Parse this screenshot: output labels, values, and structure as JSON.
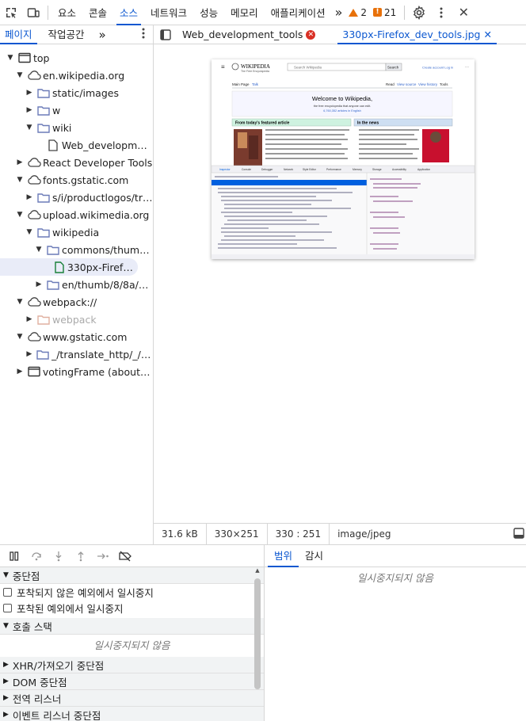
{
  "toolbar": {
    "tabs": [
      "요소",
      "콘솔",
      "소스",
      "네트워크",
      "성능",
      "메모리",
      "애플리케이션"
    ],
    "active_tab": "소스",
    "more": "»",
    "warnings": "2",
    "errors": "21"
  },
  "navigator": {
    "tabs": [
      "페이지",
      "작업공간"
    ],
    "more": "»",
    "tree": [
      {
        "label": "top",
        "depth": 0,
        "icon": "frame",
        "arrow": "down"
      },
      {
        "label": "en.wikipedia.org",
        "depth": 1,
        "icon": "cloud",
        "arrow": "down"
      },
      {
        "label": "static/images",
        "depth": 2,
        "icon": "folder",
        "arrow": "right"
      },
      {
        "label": "w",
        "depth": 2,
        "icon": "folder",
        "arrow": "right"
      },
      {
        "label": "wiki",
        "depth": 2,
        "icon": "folder",
        "arrow": "down"
      },
      {
        "label": "Web_developme…",
        "depth": 3,
        "icon": "file",
        "arrow": ""
      },
      {
        "label": "React Developer Tools",
        "depth": 1,
        "icon": "cloud",
        "arrow": "right"
      },
      {
        "label": "fonts.gstatic.com",
        "depth": 1,
        "icon": "cloud",
        "arrow": "down"
      },
      {
        "label": "s/i/productlogos/tr…",
        "depth": 2,
        "icon": "folder",
        "arrow": "right"
      },
      {
        "label": "upload.wikimedia.org",
        "depth": 1,
        "icon": "cloud",
        "arrow": "down"
      },
      {
        "label": "wikipedia",
        "depth": 2,
        "icon": "folder",
        "arrow": "down"
      },
      {
        "label": "commons/thum…",
        "depth": 3,
        "icon": "folder",
        "arrow": "down"
      },
      {
        "label": "330px-Firefox_…",
        "depth": 4,
        "icon": "file-green",
        "arrow": "",
        "selected": true
      },
      {
        "label": "en/thumb/8/8a/…",
        "depth": 3,
        "icon": "folder",
        "arrow": "right"
      },
      {
        "label": "webpack://",
        "depth": 1,
        "icon": "cloud",
        "arrow": "down"
      },
      {
        "label": "webpack",
        "depth": 2,
        "icon": "folder-faded",
        "arrow": "right",
        "faded": true
      },
      {
        "label": "www.gstatic.com",
        "depth": 1,
        "icon": "cloud",
        "arrow": "down"
      },
      {
        "label": "_/translate_http/_/s…",
        "depth": 2,
        "icon": "folder",
        "arrow": "right"
      },
      {
        "label": "votingFrame (about:…",
        "depth": 1,
        "icon": "frame",
        "arrow": "right"
      }
    ]
  },
  "editor": {
    "tabs": [
      {
        "label": "Web_development_tools",
        "close": "error"
      },
      {
        "label": "330px-Firefox_dev_tools.jpg",
        "close": "x",
        "active": true
      }
    ],
    "preview_alt": "",
    "status": {
      "size": "31.6 kB",
      "dimensions": "330×251",
      "cursor": "330 : 251",
      "mime": "image/jpeg"
    }
  },
  "preview_content": {
    "wiki_title": "WIKIPEDIA",
    "wiki_subtitle": "The Free Encyclopedia",
    "search_placeholder": "Search Wikipedia",
    "search_button": "Search",
    "top_links": "Create account  Log in",
    "tabs_left": [
      "Main Page",
      "Talk"
    ],
    "tabs_right": [
      "Read",
      "View source",
      "View history",
      "Tools"
    ],
    "welcome": "Welcome to Wikipedia,",
    "welcome_sub": "the free encyclopedia that anyone can edit.",
    "welcome_count": "6,760,352 articles in English",
    "featured_header": "From today's featured article",
    "news_header": "In the news",
    "devtools_tabs": [
      "Inspector",
      "Console",
      "Debugger",
      "Network",
      "Style Editor",
      "Performance",
      "Memory",
      "Storage",
      "Accessibility",
      "Application"
    ]
  },
  "debugger": {
    "sections": {
      "breakpoints": "중단점",
      "callstack": "호출 스택",
      "xhr": "XHR/가져오기 중단점",
      "dom": "DOM 중단점",
      "global": "전역 리스너",
      "event": "이벤트 리스너 중단점"
    },
    "checkboxes": [
      "포착되지 않은 예외에서 일시중지",
      "포착된 예외에서 일시중지"
    ],
    "not_paused": "일시중지되지 않음"
  },
  "scope": {
    "tabs": [
      "범위",
      "감시"
    ],
    "not_paused": "일시중지되지 않음"
  },
  "colors": {
    "accent": "#0b57d0",
    "warning": "#e8710a",
    "error": "#d93025",
    "folder": "#6b7bb8"
  }
}
